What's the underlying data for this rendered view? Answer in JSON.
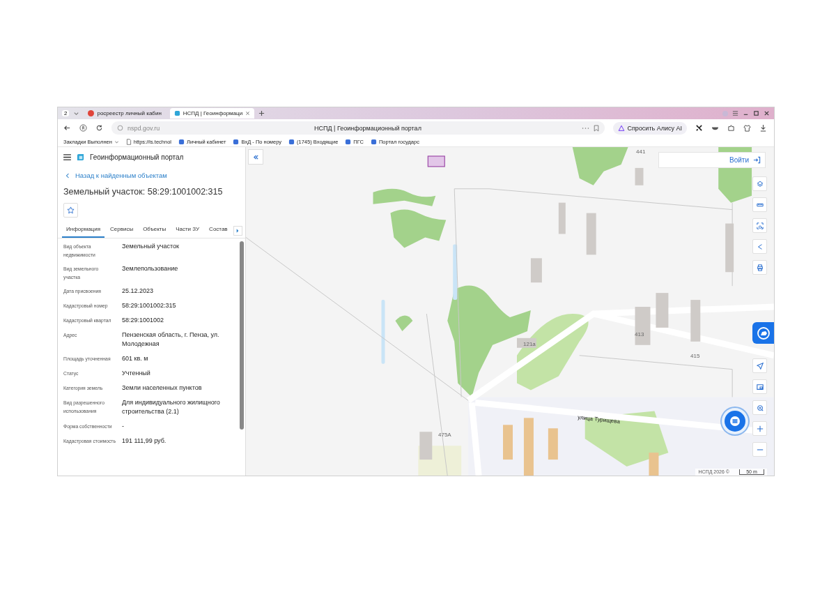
{
  "browser": {
    "tab_count": "2",
    "tabs": [
      {
        "title": "росреестр личный кабин",
        "selected": false
      },
      {
        "title": "НСПД | Геоинформаци",
        "selected": true
      }
    ],
    "address": "nspd.gov.ru",
    "page_title": "НСПД | Геоинформационный портал",
    "assistant_button": "Спросить Алису AI",
    "bookmarks": [
      {
        "title": "Закладки Выполнен",
        "kind": "folder"
      },
      {
        "title": "https://is.technol",
        "kind": "page"
      },
      {
        "title": "Личный кабинет",
        "kind": "site"
      },
      {
        "title": "ВхД - По номеру",
        "kind": "site"
      },
      {
        "title": "(1745) Входящие",
        "kind": "site"
      },
      {
        "title": "ПГС",
        "kind": "site"
      },
      {
        "title": "Портал государс",
        "kind": "site"
      }
    ]
  },
  "sidebar": {
    "app_title": "Геоинформационный портал",
    "back_link": "Назад к найденным объектам",
    "heading": "Земельный участок: 58:29:1001002:315",
    "tabs": [
      {
        "label": "Информация",
        "selected": true
      },
      {
        "label": "Сервисы",
        "selected": false
      },
      {
        "label": "Объекты",
        "selected": false
      },
      {
        "label": "Части ЗУ",
        "selected": false
      },
      {
        "label": "Состав",
        "selected": false
      }
    ],
    "fields": [
      {
        "label": "Вид объекта недвижимости",
        "value": "Земельный участок"
      },
      {
        "label": "Вид земельного участка",
        "value": "Землепользование"
      },
      {
        "label": "Дата присвоения",
        "value": "25.12.2023"
      },
      {
        "label": "Кадастровый номер",
        "value": "58:29:1001002:315"
      },
      {
        "label": "Кадастровый квартал",
        "value": "58:29:1001002"
      },
      {
        "label": "Адрес",
        "value": "Пензенская область, г. Пенза, ул. Молодежная"
      },
      {
        "label": "Площадь уточненная",
        "value": "601 кв. м"
      },
      {
        "label": "Статус",
        "value": "Учтенный"
      },
      {
        "label": "Категория земель",
        "value": "Земли населенных пунктов"
      },
      {
        "label": "Вид разрешенного использования",
        "value": "Для индивидуального жилищного строительства (2.1)"
      },
      {
        "label": "Форма собственности",
        "value": "-"
      },
      {
        "label": "Кадастровая стоимость",
        "value": "191 111,99 руб."
      }
    ]
  },
  "map": {
    "login": "Войти",
    "labels": [
      {
        "text": "441",
        "kind": "house"
      },
      {
        "text": "121а",
        "kind": "house"
      },
      {
        "text": "413",
        "kind": "house"
      },
      {
        "text": "415",
        "kind": "house"
      },
      {
        "text": "475А",
        "kind": "house"
      },
      {
        "text": "улица Турищева",
        "kind": "street"
      }
    ],
    "attribution": "НСПД 2026 ©",
    "scale": "50 m"
  }
}
